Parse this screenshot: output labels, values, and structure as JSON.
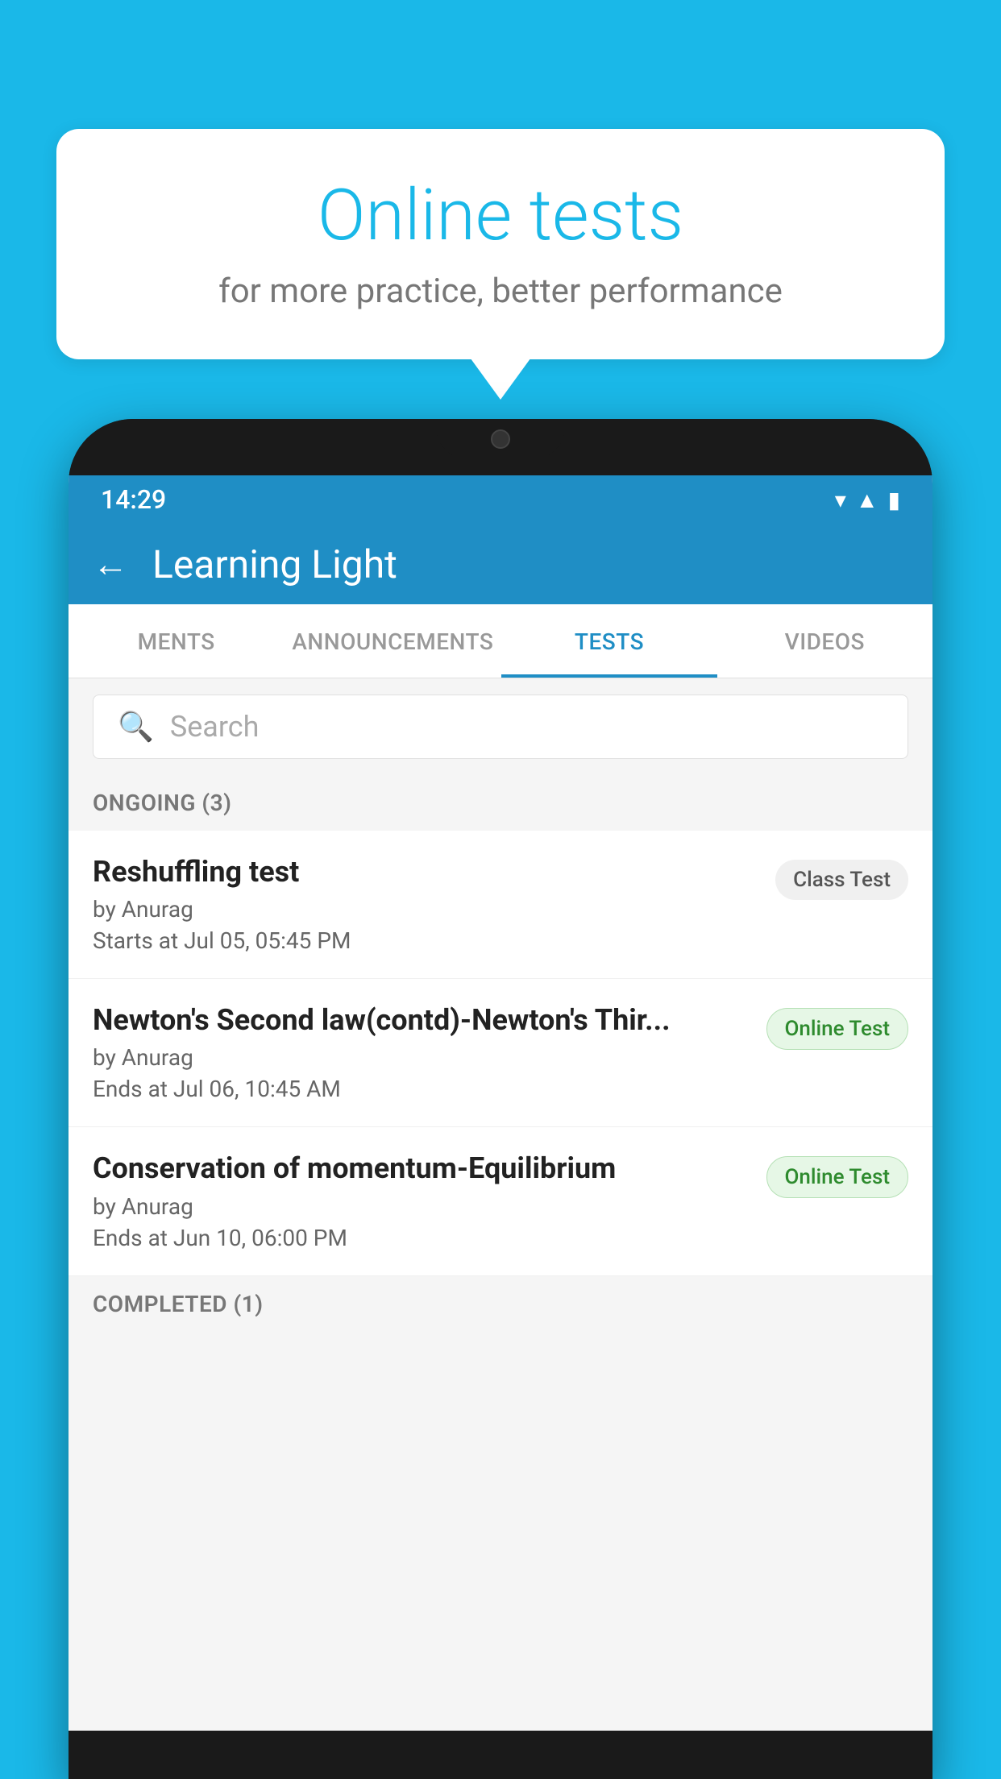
{
  "background_color": "#1ab8e8",
  "bubble": {
    "title": "Online tests",
    "subtitle": "for more practice, better performance"
  },
  "phone": {
    "status_bar": {
      "time": "14:29",
      "icons": [
        "wifi",
        "signal",
        "battery"
      ]
    },
    "header": {
      "back_label": "←",
      "title": "Learning Light"
    },
    "tabs": [
      {
        "label": "MENTS",
        "active": false
      },
      {
        "label": "ANNOUNCEMENTS",
        "active": false
      },
      {
        "label": "TESTS",
        "active": true
      },
      {
        "label": "VIDEOS",
        "active": false
      }
    ],
    "search": {
      "placeholder": "Search"
    },
    "ongoing_section": {
      "label": "ONGOING (3)"
    },
    "test_items": [
      {
        "title": "Reshuffling test",
        "author": "by Anurag",
        "date": "Starts at  Jul 05, 05:45 PM",
        "badge": "Class Test",
        "badge_type": "class"
      },
      {
        "title": "Newton's Second law(contd)-Newton's Thir...",
        "author": "by Anurag",
        "date": "Ends at  Jul 06, 10:45 AM",
        "badge": "Online Test",
        "badge_type": "online"
      },
      {
        "title": "Conservation of momentum-Equilibrium",
        "author": "by Anurag",
        "date": "Ends at  Jun 10, 06:00 PM",
        "badge": "Online Test",
        "badge_type": "online"
      }
    ],
    "completed_section": {
      "label": "COMPLETED (1)"
    }
  }
}
